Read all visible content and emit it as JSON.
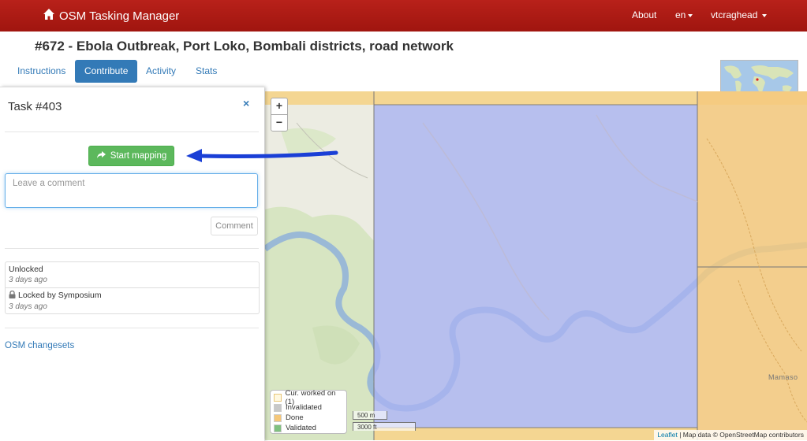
{
  "navbar": {
    "brand": "OSM Tasking Manager",
    "about": "About",
    "language": "en",
    "user": "vtcraghead"
  },
  "project": {
    "title": "#672 - Ebola Outbreak, Port Loko, Bombali districts, road network"
  },
  "tabs": [
    {
      "label": "Instructions",
      "active": false
    },
    {
      "label": "Contribute",
      "active": true
    },
    {
      "label": "Activity",
      "active": false
    },
    {
      "label": "Stats",
      "active": false
    }
  ],
  "task_panel": {
    "title": "Task #403",
    "close": "×",
    "start_mapping": "Start mapping",
    "comment_placeholder": "Leave a comment",
    "comment_button": "Comment",
    "history": [
      {
        "action": "Unlocked",
        "time": "3 days ago",
        "locked": false
      },
      {
        "action": "Locked by Symposium",
        "time": "3 days ago",
        "locked": true
      }
    ],
    "changesets_link": "OSM changesets"
  },
  "map": {
    "zoom_in": "+",
    "zoom_out": "−",
    "place_label": "Mamaso",
    "legend": [
      {
        "label": "Cur. worked on (1)",
        "color": "#fff8e0"
      },
      {
        "label": "Invalidated",
        "color": "#c8c8c8"
      },
      {
        "label": "Done",
        "color": "#f5c77a"
      },
      {
        "label": "Validated",
        "color": "#80c080"
      }
    ],
    "scale_metric": "500 m",
    "scale_imperial": "3000 ft",
    "attribution_leaflet": "Leaflet",
    "attribution_text": "| Map data © OpenStreetMap contributors"
  },
  "colors": {
    "navbar": "#ad1b14",
    "accent": "#337ab7",
    "success": "#5cb85c",
    "selected_task": "#b8c0ee",
    "done_task": "#f5c77a"
  }
}
